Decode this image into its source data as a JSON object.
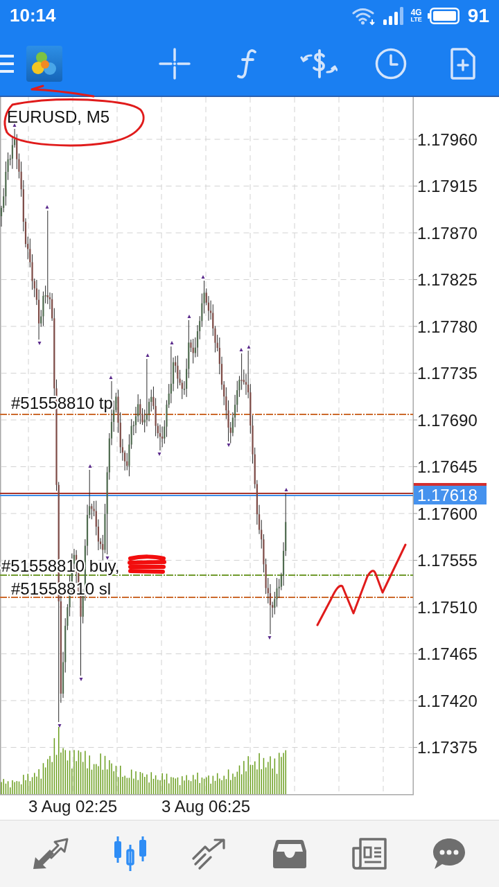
{
  "status_bar": {
    "time": "10:14",
    "network": [
      "4G",
      "LTE"
    ],
    "battery": "91"
  },
  "chart": {
    "title": "EURUSD, M5",
    "price_labels": [
      "1.17960",
      "1.17915",
      "1.17870",
      "1.17825",
      "1.17780",
      "1.17735",
      "1.17690",
      "1.17645",
      "1.17600",
      "1.17555",
      "1.17510",
      "1.17465",
      "1.17420",
      "1.17375"
    ],
    "current_price": "1.17618",
    "time_labels": [
      "3 Aug 02:25",
      "3 Aug 06:25"
    ],
    "order_lines": [
      {
        "kind": "tp",
        "label": "#51558810 tp",
        "color": "#cc6a2c"
      },
      {
        "kind": "buy",
        "label": "#51558810 buy,",
        "color": "#6f9a2c"
      },
      {
        "kind": "sl",
        "label": "#51558810 sl",
        "color": "#cc6a2c"
      }
    ]
  },
  "bottom_nav": {
    "items": [
      {
        "kind": "quotes",
        "selected": false
      },
      {
        "kind": "chart",
        "selected": true
      },
      {
        "kind": "trade",
        "selected": false
      },
      {
        "kind": "history",
        "selected": false
      },
      {
        "kind": "news",
        "selected": false
      },
      {
        "kind": "chat",
        "selected": false
      }
    ]
  }
}
